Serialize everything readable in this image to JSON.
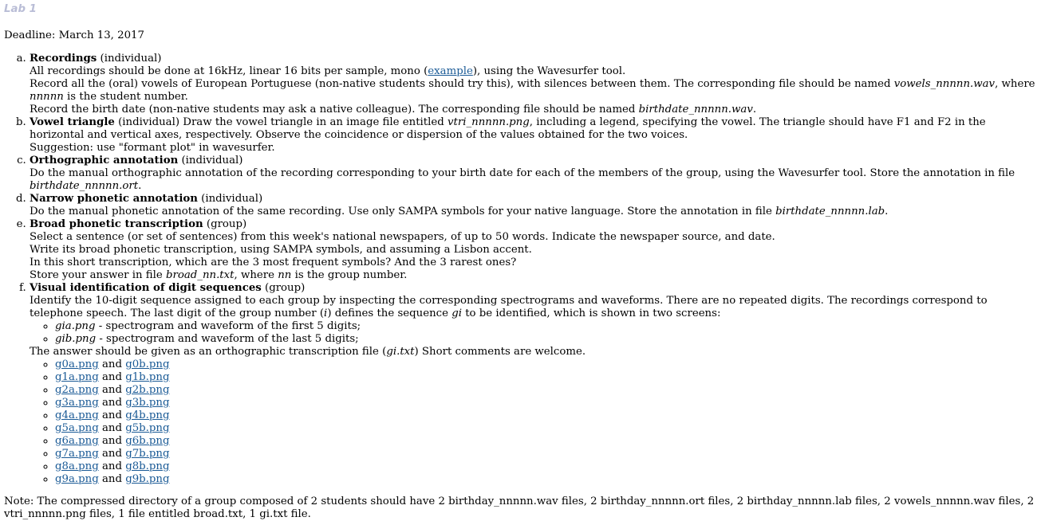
{
  "title": "Lab 1",
  "deadline": "Deadline: March 13, 2017",
  "items": {
    "a": {
      "heading": "Recordings",
      "scope": "(individual)",
      "l1_pre": "All recordings should be done at 16kHz, linear 16 bits per sample, mono (",
      "l1_link": "example",
      "l1_post": "), using the Wavesurfer tool.",
      "l2_pre": "Record all the (oral) vowels of European Portuguese (non-native students should try this), with silences between them. The corresponding file should be named ",
      "l2_file": "vowels_nnnnn.wav",
      "l2_mid": ", where ",
      "l2_var": "nnnnn",
      "l2_post": " is the student number.",
      "l3_pre": "Record the birth date (non-native students may ask a native colleague). The corresponding file should be named ",
      "l3_file": "birthdate_nnnnn.wav",
      "l3_post": "."
    },
    "b": {
      "heading": "Vowel triangle",
      "scope": "(individual)",
      "l1_pre": " Draw the vowel triangle in an image file entitled ",
      "l1_file": "vtri_nnnnn.png",
      "l1_post": ", including a legend, specifying the vowel. The triangle should have F1 and F2 in the horizontal and vertical axes, respectively. Observe the coincidence or dispersion of the values obtained for the two voices.",
      "l2": "Suggestion: use \"formant plot\" in wavesurfer."
    },
    "c": {
      "heading": "Orthographic annotation",
      "scope": "(individual)",
      "l1_pre": "Do the manual orthographic annotation of the recording corresponding to your birth date for each of the members of the group, using the Wavesurfer tool. Store the annotation in file ",
      "l1_file": "birthdate_nnnnn.ort",
      "l1_post": "."
    },
    "d": {
      "heading": "Narrow phonetic annotation",
      "scope": "(individual)",
      "l1_pre": "Do the manual phonetic annotation of the same recording. Use only SAMPA symbols for your native language. Store the annotation in file ",
      "l1_file": "birthdate_nnnnn.lab",
      "l1_post": "."
    },
    "e": {
      "heading": "Broad phonetic transcription",
      "scope": "(group)",
      "l1": "Select a sentence (or set of sentences) from this week's national newspapers, of up to 50 words. Indicate the newspaper source, and date.",
      "l2": "Write its broad phonetic transcription, using SAMPA symbols, and assuming a Lisbon accent.",
      "l3": "In this short transcription, which are the 3 most frequent symbols? And the 3 rarest ones?",
      "l4_pre": "Store your answer in file ",
      "l4_file": "broad_nn.txt",
      "l4_mid": ", where ",
      "l4_var": "nn",
      "l4_post": " is the group number."
    },
    "f": {
      "heading": "Visual identification of digit sequences",
      "scope": "(group)",
      "l1_pre": "Identify the 10-digit sequence assigned to each group by inspecting the corresponding spectrograms and waveforms. There are no repeated digits. The recordings correspond to telephone speech. The last digit of the group number (",
      "l1_i": "i",
      "l1_mid": ") defines the sequence ",
      "l1_gi": "gi",
      "l1_post": " to be identified, which is shown in two screens:",
      "screens": [
        {
          "file": "gia.png",
          "desc": " - spectrogram and waveform of the first 5 digits;"
        },
        {
          "file": "gib.png",
          "desc": " - spectrogram and waveform of the last 5 digits;"
        }
      ],
      "answer_pre": "The answer should be given as an orthographic transcription file (",
      "answer_file": "gi.txt",
      "answer_post": ") Short comments are welcome.",
      "and_word": "and",
      "files": [
        [
          "g0a.png",
          "g0b.png"
        ],
        [
          "g1a.png",
          "g1b.png"
        ],
        [
          "g2a.png",
          "g2b.png"
        ],
        [
          "g3a.png",
          "g3b.png"
        ],
        [
          "g4a.png",
          "g4b.png"
        ],
        [
          "g5a.png",
          "g5b.png"
        ],
        [
          "g6a.png",
          "g6b.png"
        ],
        [
          "g7a.png",
          "g7b.png"
        ],
        [
          "g8a.png",
          "g8b.png"
        ],
        [
          "g9a.png",
          "g9b.png"
        ]
      ]
    }
  },
  "note": "Note: The compressed directory of a group composed of 2 students should have 2 birthday_nnnnn.wav files, 2 birthday_nnnnn.ort files, 2 birthday_nnnnn.lab files, 2 vowels_nnnnn.wav files, 2 vtri_nnnnn.png files, 1 file entitled broad.txt, 1 gi.txt file."
}
